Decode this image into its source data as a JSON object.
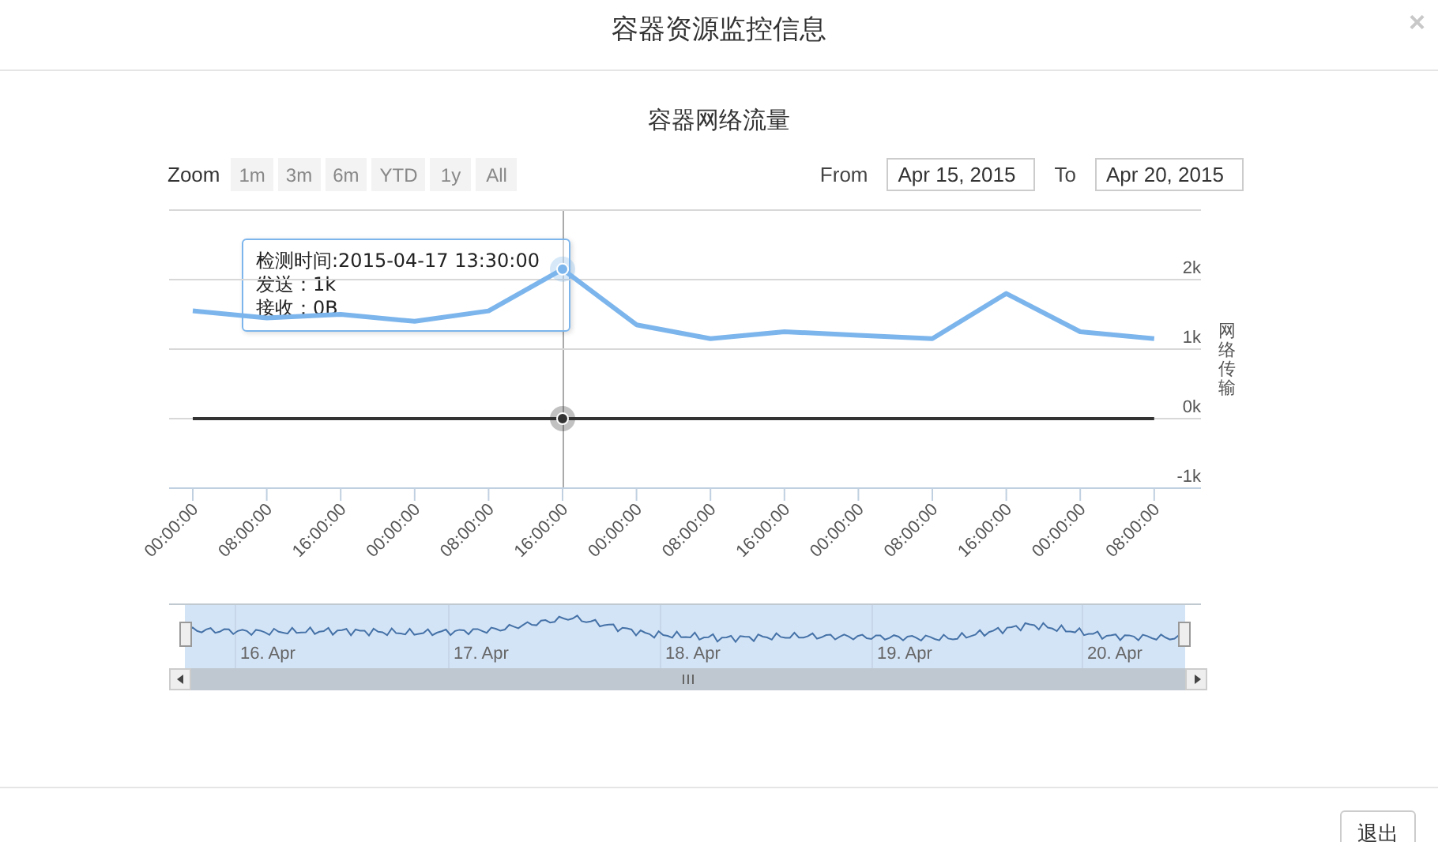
{
  "dialog": {
    "title": "容器资源监控信息",
    "close": "×"
  },
  "chart": {
    "title": "容器网络流量",
    "zoom_label": "Zoom",
    "zoom_buttons": [
      {
        "label": "1m",
        "disabled": true
      },
      {
        "label": "3m",
        "disabled": true
      },
      {
        "label": "6m",
        "disabled": true
      },
      {
        "label": "YTD",
        "disabled": true
      },
      {
        "label": "1y",
        "disabled": true
      },
      {
        "label": "All",
        "disabled": true
      }
    ],
    "from_label": "From",
    "from_value": "Apr 15, 2015",
    "to_label": "To",
    "to_value": "Apr 20, 2015",
    "tooltip": {
      "title": "检测时间:2015-04-17 13:30:00",
      "values": [
        "：1k",
        "：0B"
      ]
    },
    "chart_data": {
      "type": "line",
      "ylabel": "网络传输",
      "grid": true,
      "categories": [
        "00:00:00",
        "08:00:00",
        "16:00:00",
        "00:00:00",
        "08:00:00",
        "16:00:00",
        "00:00:00",
        "08:00:00",
        "16:00:00",
        "00:00:00",
        "08:00:00",
        "16:00:00",
        "00:00:00",
        "08:00:00"
      ],
      "series": [
        {
          "name": "发送",
          "color": "#7cb5ec",
          "values": [
            1550,
            1450,
            1500,
            1400,
            1550,
            2150,
            1350,
            1150,
            1250,
            1200,
            1150,
            1800,
            1250,
            1150
          ]
        },
        {
          "name": "接收",
          "color": "#333333",
          "values": [
            0,
            0,
            0,
            0,
            0,
            0,
            0,
            0,
            0,
            0,
            0,
            0,
            0,
            0
          ]
        }
      ],
      "ylim": [
        -1000,
        3000
      ],
      "yticks": [
        {
          "value": -1000,
          "label": "-1k"
        },
        {
          "value": 0,
          "label": "0k"
        },
        {
          "value": 1000,
          "label": "1k"
        },
        {
          "value": 2000,
          "label": "2k"
        }
      ]
    },
    "navigator": {
      "labels": [
        "16. Apr",
        "17. Apr",
        "18. Apr",
        "19. Apr",
        "20. Apr"
      ]
    }
  },
  "buttons": [
    {
      "label": "退出"
    }
  ]
}
